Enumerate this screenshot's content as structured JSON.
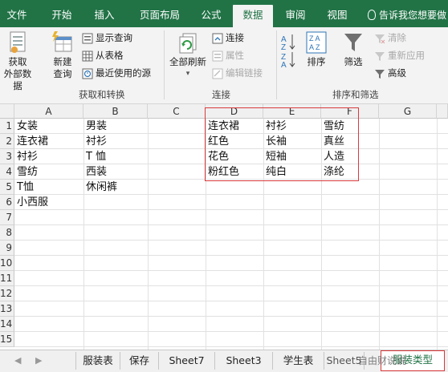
{
  "ribbon": {
    "tabs": [
      "文件",
      "开始",
      "插入",
      "页面布局",
      "公式",
      "数据",
      "审阅",
      "视图"
    ],
    "active_tab": "数据",
    "tell_me": "告诉我您想要做",
    "groups": {
      "get_transform": {
        "label": "获取和转换",
        "external_data": [
          "获取",
          "外部数据"
        ],
        "new_query": [
          "新建",
          "查询"
        ],
        "show_query": "显示查询",
        "from_table": "从表格",
        "recent_sources": "最近使用的源"
      },
      "connections": {
        "label": "连接",
        "refresh_all": "全部刷新",
        "connections": "连接",
        "properties": "属性",
        "edit_links": "编辑链接"
      },
      "sort_filter": {
        "label": "排序和筛选",
        "sort": "排序",
        "filter": "筛选",
        "clear": "清除",
        "reapply": "重新应用",
        "advanced": "高级"
      }
    }
  },
  "sheet": {
    "columns": [
      "A",
      "B",
      "C",
      "D",
      "E",
      "F",
      "G"
    ],
    "rows": [
      "1",
      "2",
      "3",
      "4",
      "5",
      "6",
      "7",
      "8",
      "9",
      "10",
      "11",
      "12",
      "13",
      "14",
      "15"
    ],
    "col_a": [
      "女装",
      "连衣裙",
      "衬衫",
      "雪纺",
      "T恤",
      "小西服"
    ],
    "col_b": [
      "男装",
      "衬衫",
      "T 恤",
      "西装",
      "休闲裤"
    ],
    "col_d": [
      "连衣裙",
      "红色",
      "花色",
      "粉红色"
    ],
    "col_e": [
      "衬衫",
      "长袖",
      "短袖",
      "纯白"
    ],
    "col_f": [
      "雪纺",
      "真丝",
      "人造",
      "涤纶"
    ]
  },
  "sheet_tabs": {
    "tabs": [
      "服装表",
      "保存",
      "Sheet7",
      "Sheet3",
      "学生表",
      "Sheet5"
    ],
    "active": "服装类型",
    "active_visible": "服装类型"
  },
  "watermark": "自由财说说",
  "colors": {
    "excel_green": "#217346",
    "highlight_red": "#d9393b"
  }
}
